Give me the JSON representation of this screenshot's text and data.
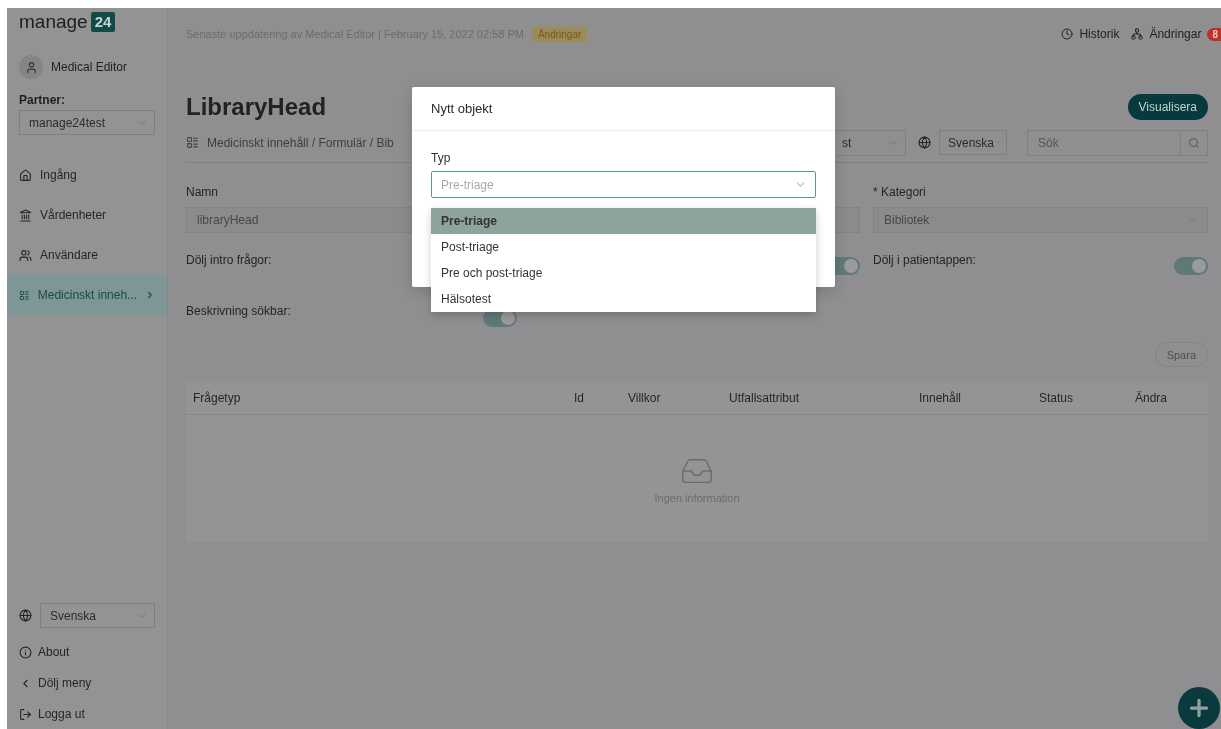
{
  "brand": {
    "name": "manage",
    "badge": "24"
  },
  "user": {
    "name": "Medical Editor"
  },
  "partner": {
    "label": "Partner:",
    "value": "manage24test"
  },
  "nav": [
    {
      "label": "Ingång",
      "selected": false
    },
    {
      "label": "Vårdenheter",
      "selected": false
    },
    {
      "label": "Användare",
      "selected": false
    },
    {
      "label": "Medicinskt inneh...",
      "selected": true
    }
  ],
  "sidebar_footer": {
    "language": "Svenska",
    "links": [
      "About",
      "Dölj meny",
      "Logga ut"
    ]
  },
  "topbar": {
    "update_text": "Senaste uppdatering av Medical Editor | February 15, 2022 02:58 PM",
    "changes_tag": "Ändringar",
    "history": "Historik",
    "changes": "Ändringar",
    "changes_count": "8"
  },
  "page": {
    "title": "LibraryHead",
    "visualize_button": "Visualisera",
    "breadcrumb": "Medicinskt innehåll / Formulär / Bib",
    "partner_select": "st",
    "language_select": "Svenska",
    "search_placeholder": "Sök",
    "name_label": "Namn",
    "name_value": "libraryHead",
    "category_required_mark": "*",
    "category_label": "Kategori",
    "category_value": "Bibliotek",
    "toggles": [
      {
        "label": "Dölj intro frågor:",
        "on": true
      },
      {
        "label": "Dölj i patientappen:",
        "on": true
      },
      {
        "label": "Beskrivning sökbar:",
        "on": true
      }
    ],
    "save_button": "Spara",
    "table": {
      "columns": [
        "Frågetyp",
        "Id",
        "Villkor",
        "Utfallsattribut",
        "Innehåll",
        "Status",
        "Ändra"
      ],
      "empty_text": "Ingen information"
    }
  },
  "modal": {
    "title": "Nytt objekt",
    "field_label": "Typ",
    "placeholder": "Pre-triage",
    "options": [
      {
        "label": "Pre-triage",
        "selected": true
      },
      {
        "label": "Post-triage",
        "selected": false
      },
      {
        "label": "Pre och post-triage",
        "selected": false
      },
      {
        "label": "Hälsotest",
        "selected": false
      }
    ]
  }
}
